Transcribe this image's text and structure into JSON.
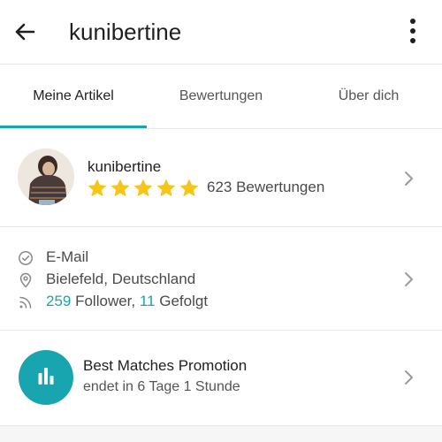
{
  "appbar": {
    "title": "kunibertine",
    "back_icon": "arrow-left-icon",
    "menu_icon": "more-vertical-icon"
  },
  "tabs": [
    {
      "label": "Meine Artikel",
      "active": true
    },
    {
      "label": "Bewertungen",
      "active": false
    },
    {
      "label": "Über dich",
      "active": false
    }
  ],
  "profile": {
    "username": "kunibertine",
    "stars": 5,
    "rating_text": "623 Bewertungen"
  },
  "info": {
    "email": "E-Mail",
    "location": "Bielefeld, Deutschland",
    "followers_count": "259",
    "followers_label": " Follower, ",
    "following_count": "11",
    "following_label": " Gefolgt"
  },
  "promotion": {
    "title": "Best Matches Promotion",
    "subtitle": "endet in 6 Tage 1 Stunde"
  },
  "colors": {
    "accent": "#18a5b0",
    "star": "#f5c518"
  }
}
